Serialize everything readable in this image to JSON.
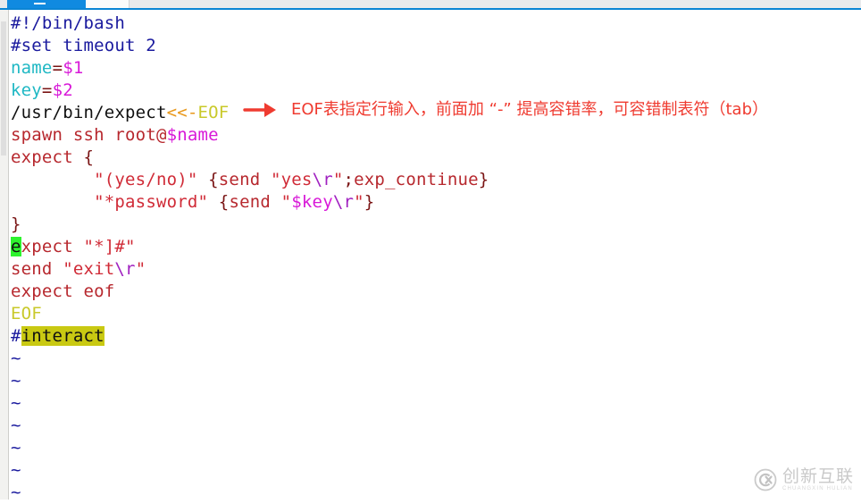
{
  "window": {
    "tab_active_label": "",
    "tab_minimize_icon": "minimize-icon",
    "tab_inactive_label": ""
  },
  "editor": {
    "app": "vim",
    "lines": [
      {
        "index": 1,
        "text": "#!/bin/bash",
        "tokens": [
          {
            "t": "#!/bin/bash",
            "c": "tok-comment"
          }
        ]
      },
      {
        "index": 2,
        "text": "#set timeout 2",
        "tokens": [
          {
            "t": "#set timeout 2",
            "c": "tok-comment"
          }
        ]
      },
      {
        "index": 3,
        "text": "name=$1",
        "tokens": [
          {
            "t": "name",
            "c": "tok-var"
          },
          {
            "t": "=",
            "c": "tok-op"
          },
          {
            "t": "$1",
            "c": "tok-dollar"
          }
        ]
      },
      {
        "index": 4,
        "text": "key=$2",
        "tokens": [
          {
            "t": "key",
            "c": "tok-var"
          },
          {
            "t": "=",
            "c": "tok-op"
          },
          {
            "t": "$2",
            "c": "tok-dollar"
          }
        ]
      },
      {
        "index": 5,
        "text": "/usr/bin/expect<<-EOF",
        "tokens": [
          {
            "t": "/usr/bin/expect",
            "c": "tok-plain"
          },
          {
            "t": "<<-",
            "c": "tok-redirect"
          },
          {
            "t": "EOF",
            "c": "tok-heredoc"
          }
        ]
      },
      {
        "index": 6,
        "text": "spawn ssh root@$name",
        "tokens": [
          {
            "t": "spawn ssh root@",
            "c": "tok-cmd"
          },
          {
            "t": "$name",
            "c": "tok-dollar"
          }
        ]
      },
      {
        "index": 7,
        "text": "expect {",
        "tokens": [
          {
            "t": "expect ",
            "c": "tok-cmd"
          },
          {
            "t": "{",
            "c": "tok-brace"
          }
        ]
      },
      {
        "index": 8,
        "text": "        \"(yes/no)\" {send \"yes\\r\";exp_continue}",
        "tokens": [
          {
            "t": "        ",
            "c": "tok-plain"
          },
          {
            "t": "\"(yes/no)\"",
            "c": "tok-string"
          },
          {
            "t": " ",
            "c": "tok-plain"
          },
          {
            "t": "{",
            "c": "tok-brace"
          },
          {
            "t": "send ",
            "c": "tok-cmd"
          },
          {
            "t": "\"yes",
            "c": "tok-string"
          },
          {
            "t": "\\r",
            "c": "tok-escape"
          },
          {
            "t": "\"",
            "c": "tok-string"
          },
          {
            "t": ";",
            "c": "tok-brace"
          },
          {
            "t": "exp_continue",
            "c": "tok-cmd"
          },
          {
            "t": "}",
            "c": "tok-brace"
          }
        ]
      },
      {
        "index": 9,
        "text": "        \"*password\" {send \"$key\\r\"}",
        "tokens": [
          {
            "t": "        ",
            "c": "tok-plain"
          },
          {
            "t": "\"*password\"",
            "c": "tok-string"
          },
          {
            "t": " ",
            "c": "tok-plain"
          },
          {
            "t": "{",
            "c": "tok-brace"
          },
          {
            "t": "send ",
            "c": "tok-cmd"
          },
          {
            "t": "\"",
            "c": "tok-string"
          },
          {
            "t": "$key",
            "c": "tok-dollar"
          },
          {
            "t": "\\r",
            "c": "tok-escape"
          },
          {
            "t": "\"",
            "c": "tok-string"
          },
          {
            "t": "}",
            "c": "tok-brace"
          }
        ]
      },
      {
        "index": 10,
        "text": "}",
        "tokens": [
          {
            "t": "}",
            "c": "tok-brace"
          }
        ]
      },
      {
        "index": 11,
        "text": "expect \"*]#\"",
        "tokens": [
          {
            "t": "e",
            "c": "tok-cmd cursor-block"
          },
          {
            "t": "xpect ",
            "c": "tok-cmd"
          },
          {
            "t": "\"*]#\"",
            "c": "tok-string"
          }
        ]
      },
      {
        "index": 12,
        "text": "send \"exit\\r\"",
        "tokens": [
          {
            "t": "send ",
            "c": "tok-cmd"
          },
          {
            "t": "\"exit",
            "c": "tok-string"
          },
          {
            "t": "\\r",
            "c": "tok-escape"
          },
          {
            "t": "\"",
            "c": "tok-string"
          }
        ]
      },
      {
        "index": 13,
        "text": "expect eof",
        "tokens": [
          {
            "t": "expect eof",
            "c": "tok-cmd"
          }
        ]
      },
      {
        "index": 14,
        "text": "EOF",
        "tokens": [
          {
            "t": "EOF",
            "c": "tok-heredoc"
          }
        ]
      },
      {
        "index": 15,
        "text": "#interact",
        "tokens": [
          {
            "t": "#",
            "c": "tok-comment"
          },
          {
            "t": "interact",
            "c": "tok-comment search-hl"
          }
        ]
      },
      {
        "index": 16,
        "text": "~",
        "tokens": [
          {
            "t": "~",
            "c": "tok-tilde"
          }
        ]
      },
      {
        "index": 17,
        "text": "~",
        "tokens": [
          {
            "t": "~",
            "c": "tok-tilde"
          }
        ]
      },
      {
        "index": 18,
        "text": "~",
        "tokens": [
          {
            "t": "~",
            "c": "tok-tilde"
          }
        ]
      },
      {
        "index": 19,
        "text": "~",
        "tokens": [
          {
            "t": "~",
            "c": "tok-tilde"
          }
        ]
      },
      {
        "index": 20,
        "text": "~",
        "tokens": [
          {
            "t": "~",
            "c": "tok-tilde"
          }
        ]
      },
      {
        "index": 21,
        "text": "~",
        "tokens": [
          {
            "t": "~",
            "c": "tok-tilde"
          }
        ]
      },
      {
        "index": 22,
        "text": "~",
        "tokens": [
          {
            "t": "~",
            "c": "tok-tilde"
          }
        ]
      }
    ]
  },
  "annotation": {
    "arrow_icon": "right-arrow-icon",
    "text": "EOF表指定行输入，前面加 “-” 提高容错率，可容错制表符（tab）",
    "color": "#ef3b30"
  },
  "watermark": {
    "logo_icon": "cx-circle-logo-icon",
    "cn_text": "创新互联",
    "en_text": "CHUANGXIN HULIAN"
  },
  "colors": {
    "comment": "#1a1a9e",
    "variable": "#1fb8c4",
    "dollar": "#d819d8",
    "string": "#d02b37",
    "command": "#b7282e",
    "heredoc": "#c9c92a",
    "redirect": "#e8971a",
    "escape": "#a021c0",
    "cursor": "#2ef32e",
    "search_highlight": "#c9c912",
    "tab_blue": "#108ae0",
    "annotation_red": "#ef3b30"
  }
}
